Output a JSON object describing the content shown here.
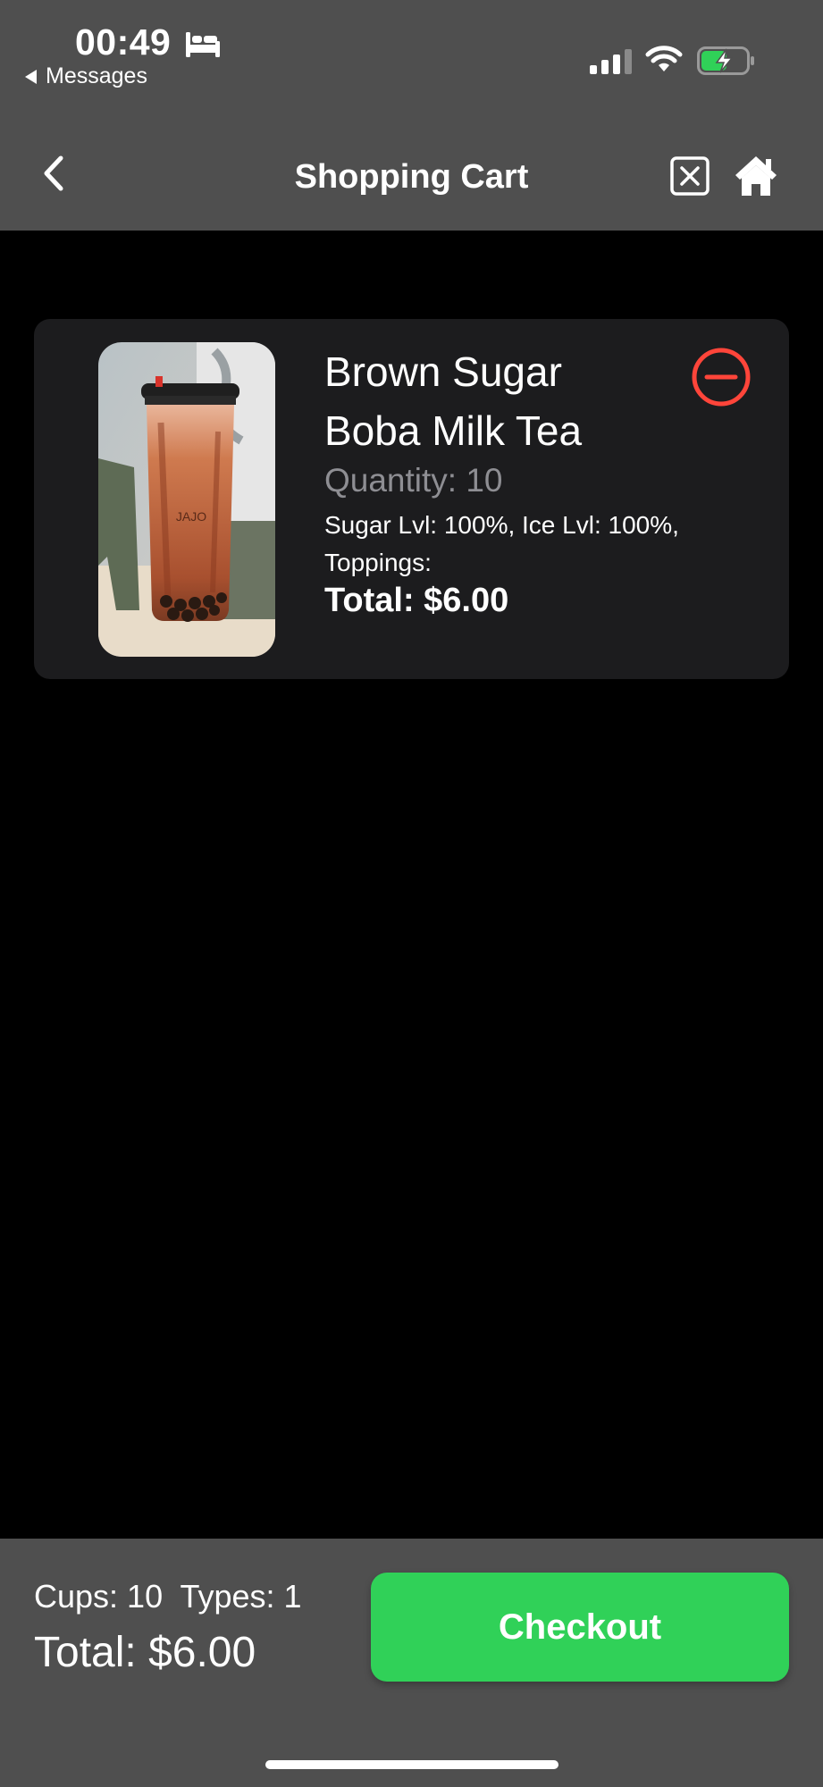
{
  "status_bar": {
    "time": "00:49",
    "back_app": "Messages",
    "icons": [
      "bed-icon",
      "signal-icon",
      "wifi-icon",
      "battery-charging-icon"
    ]
  },
  "nav": {
    "title": "Shopping Cart",
    "icons": [
      "chevron-left-icon",
      "close-box-icon",
      "home-icon"
    ]
  },
  "cart": {
    "items": [
      {
        "name": "Brown Sugar Boba Milk Tea",
        "quantity": "Quantity: 10",
        "options": "Sugar Lvl: 100%, Ice Lvl: 100%, Toppings:",
        "total": "Total: $6.00",
        "image_alt": "Brown sugar boba milk tea cup",
        "cup_logo": "JAJO"
      }
    ]
  },
  "summary": {
    "counts": "Cups: 10  Types: 1",
    "total": "Total: $6.00",
    "checkout_label": "Checkout"
  },
  "colors": {
    "bar_background": "#4f4f4f",
    "page_background": "#000000",
    "card_background": "#1c1c1e",
    "checkout_green": "#30d158",
    "remove_red": "#ff453a",
    "secondary_text": "#8e8e93"
  }
}
